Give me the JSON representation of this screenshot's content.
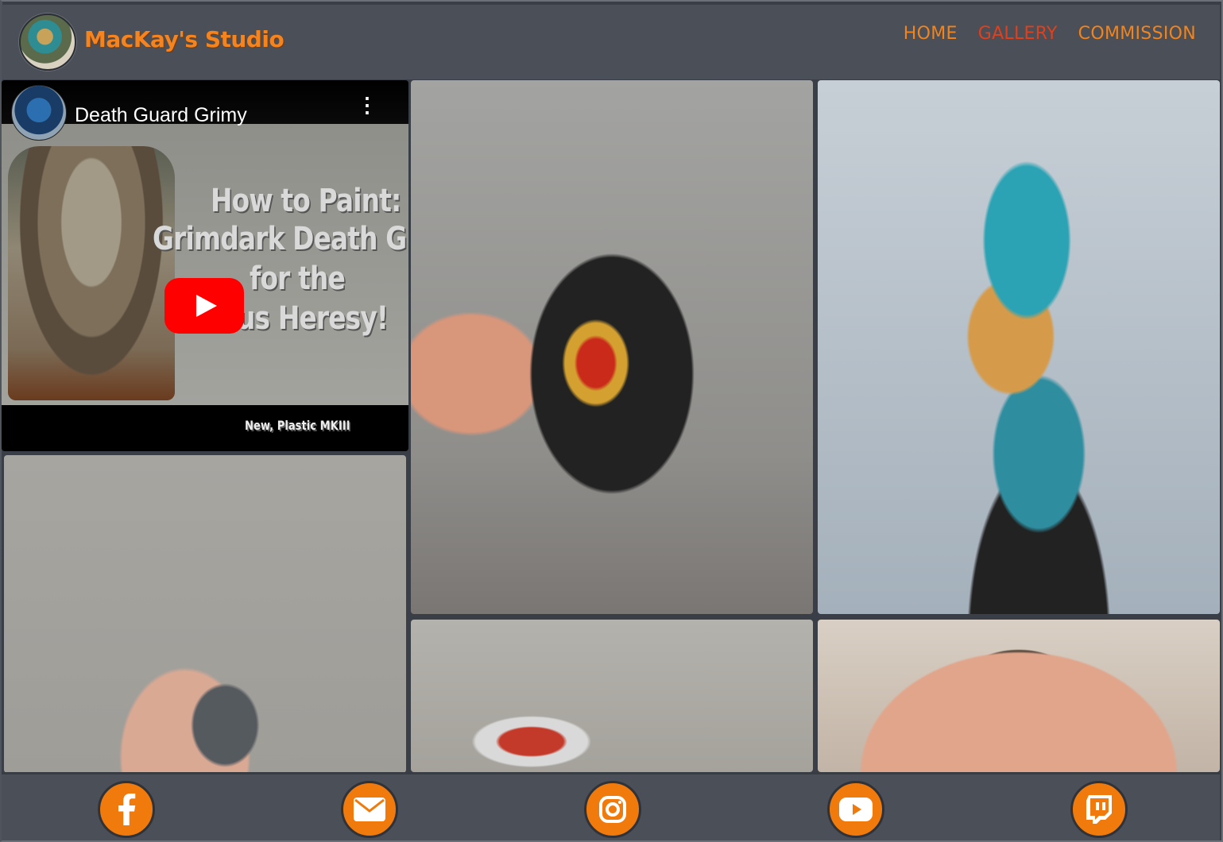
{
  "header": {
    "brand": "MacKay's Studio",
    "logo_icon": "lizard-warrior-logo",
    "nav": [
      {
        "label": "HOME",
        "active": false
      },
      {
        "label": "GALLERY",
        "active": true
      },
      {
        "label": "COMMISSION",
        "active": false
      }
    ]
  },
  "gallery": {
    "video": {
      "title": "Death Guard Grimy",
      "thumbnail_text": [
        "How to Paint:",
        "Grimdark Death Guar",
        "for the",
        "us Heresy!",
        "New, Plastic MKIII"
      ]
    }
  },
  "footer": {
    "social": [
      {
        "icon": "facebook-icon"
      },
      {
        "icon": "email-icon"
      },
      {
        "icon": "instagram-icon"
      },
      {
        "icon": "youtube-icon"
      },
      {
        "icon": "twitch-icon"
      }
    ]
  },
  "colors": {
    "accent": "#f07a0b",
    "nav_active": "#e2401b",
    "header_bg": "#4a4f58",
    "page_bg": "#3a3f47"
  }
}
